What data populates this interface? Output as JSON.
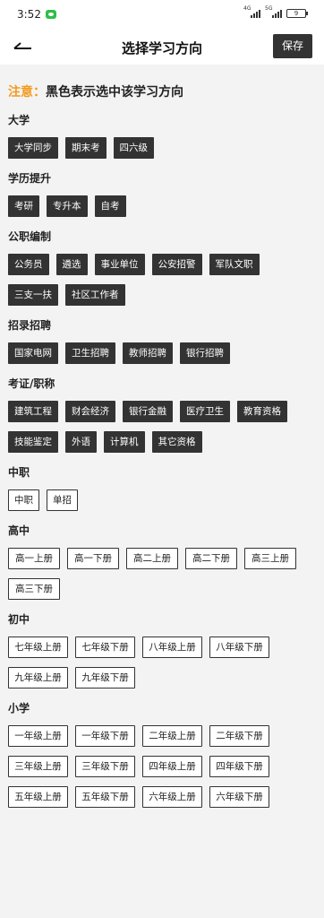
{
  "status_bar": {
    "time": "3:52",
    "signal1_label": "4G",
    "signal2_label": "5G",
    "battery": "9"
  },
  "header": {
    "title": "选择学习方向",
    "save_label": "保存"
  },
  "notice": {
    "prefix": "注意：",
    "text": "黑色表示选中该学习方向"
  },
  "sections": [
    {
      "title": "大学",
      "tags": [
        "大学同步",
        "期末考",
        "四六级"
      ]
    },
    {
      "title": "学历提升",
      "tags": [
        "考研",
        "专升本",
        "自考"
      ]
    },
    {
      "title": "公职编制",
      "tags": [
        "公务员",
        "遴选",
        "事业单位",
        "公安招警",
        "军队文职",
        "三支一扶",
        "社区工作者"
      ]
    },
    {
      "title": "招录招聘",
      "tags": [
        "国家电网",
        "卫生招聘",
        "教师招聘",
        "银行招聘"
      ]
    },
    {
      "title": "考证/职称",
      "tags": [
        "建筑工程",
        "财会经济",
        "银行金融",
        "医疗卫生",
        "教育资格",
        "技能鉴定",
        "外语",
        "计算机",
        "其它资格"
      ]
    },
    {
      "title": "中职",
      "tags": [
        "中职",
        "单招"
      ]
    },
    {
      "title": "高中",
      "tags": [
        "高一上册",
        "高一下册",
        "高二上册",
        "高二下册",
        "高三上册",
        "高三下册"
      ]
    },
    {
      "title": "初中",
      "tags": [
        "七年级上册",
        "七年级下册",
        "八年级上册",
        "八年级下册",
        "九年级上册",
        "九年级下册"
      ]
    },
    {
      "title": "小学",
      "tags": [
        "一年级上册",
        "一年级下册",
        "二年级上册",
        "二年级下册",
        "三年级上册",
        "三年级下册",
        "四年级上册",
        "四年级下册",
        "五年级上册",
        "五年级下册",
        "六年级上册",
        "六年级下册"
      ]
    }
  ],
  "colors": {
    "accent": "#f39a1e",
    "selected_bg": "#333333",
    "page_bg": "#f3f3f3"
  },
  "icons": {
    "back": "back-arrow-icon",
    "wechat": "wechat-icon"
  }
}
